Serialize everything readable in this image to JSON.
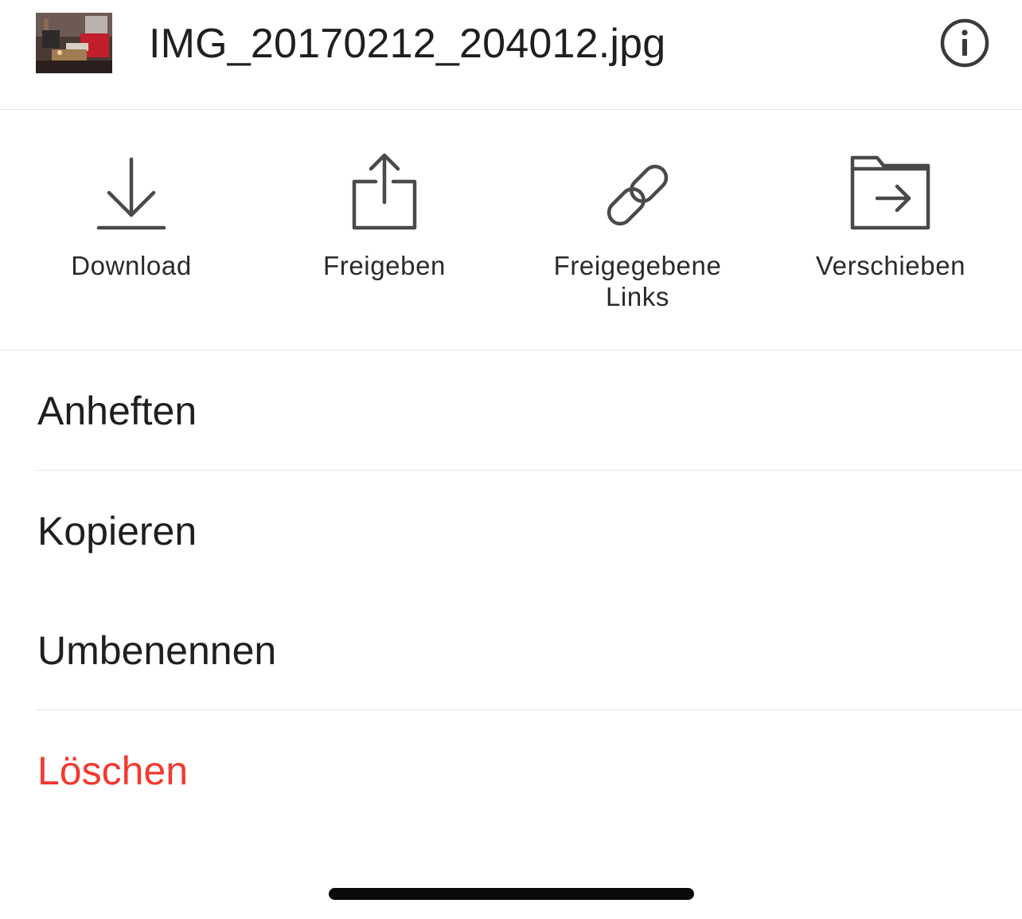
{
  "header": {
    "file_name": "IMG_20170212_204012.jpg",
    "thumbnail_icon": "photo-thumbnail",
    "info_icon": "info-circle-icon"
  },
  "actions": [
    {
      "label": "Download",
      "icon": "download-icon"
    },
    {
      "label": "Freigeben",
      "icon": "share-icon"
    },
    {
      "label": "Freigegebene\nLinks",
      "icon": "link-icon"
    },
    {
      "label": "Verschieben",
      "icon": "folder-move-icon"
    }
  ],
  "menu": {
    "items": [
      {
        "label": "Anheften"
      },
      {
        "label": "Kopieren"
      },
      {
        "label": "Umbenennen"
      },
      {
        "label": "Löschen",
        "destructive": true
      }
    ]
  },
  "colors": {
    "destructive": "#f23a30",
    "icon_stroke": "#4a4a4a",
    "separator": "#e3e3e3"
  }
}
